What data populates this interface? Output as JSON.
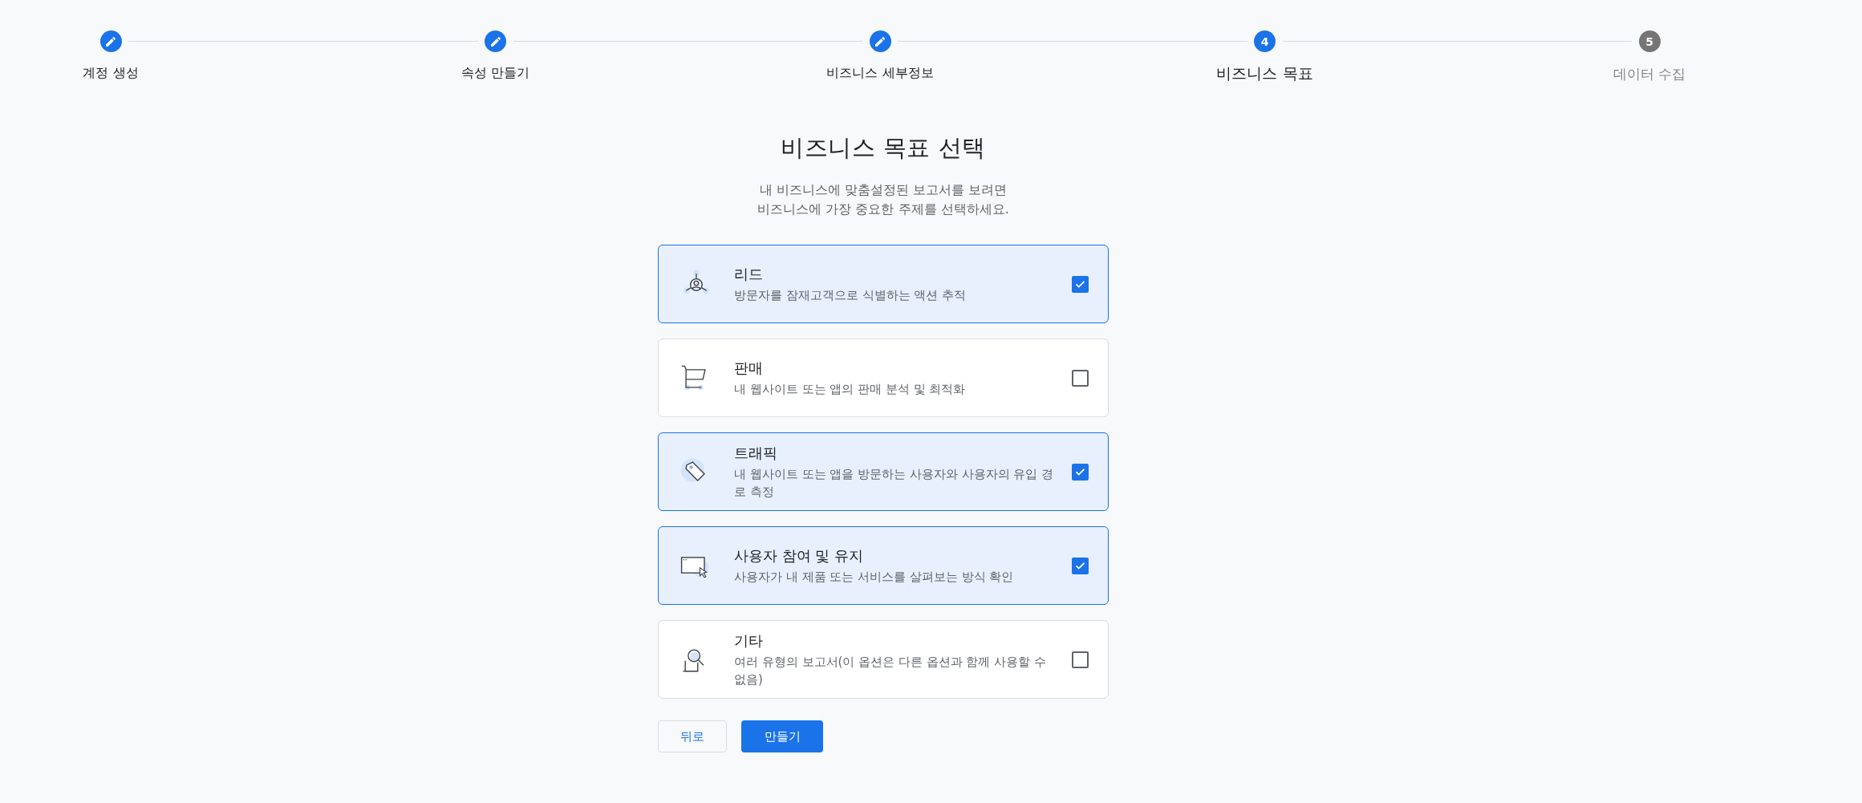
{
  "steps": [
    {
      "label": "계정 생성",
      "done": true,
      "selected": false
    },
    {
      "label": "속성 만들기",
      "done": true,
      "selected": false
    },
    {
      "label": "비즈니스 세부정보",
      "done": true,
      "selected": false
    },
    {
      "label": "비즈니스 목표",
      "done": false,
      "selected": true,
      "number": "4"
    },
    {
      "label": "데이터 수집",
      "done": false,
      "selected": false,
      "number": "5"
    }
  ],
  "title": "비즈니스 목표 선택",
  "subtitle_lines": [
    "내 비즈니스에 맞춤설정된 보고서를 보려면",
    "비즈니스에 가장 중요한 주제를 선택하세요."
  ],
  "options": [
    {
      "title": "리드",
      "description": "방문자를 잠재고객으로 식별하는 액션 추적",
      "checked": true
    },
    {
      "title": "판매",
      "description": "내 웹사이트 또는 앱의 판매 분석 및 최적화",
      "checked": false
    },
    {
      "title": "트래픽",
      "description": "내 웹사이트 또는 앱을 방문하는 사용자와 사용자의 유입 경로 측정",
      "checked": true
    },
    {
      "title": "사용자 참여 및 유지",
      "description": "사용자가 내 제품 또는 서비스를 살펴보는 방식 확인",
      "checked": true
    },
    {
      "title": "기타",
      "description": "여러 유형의 보고서(이 옵션은 다른 옵션과 함께 사용할 수 없음)",
      "checked": false
    }
  ],
  "buttons": {
    "back": "뒤로",
    "create": "만들기"
  }
}
